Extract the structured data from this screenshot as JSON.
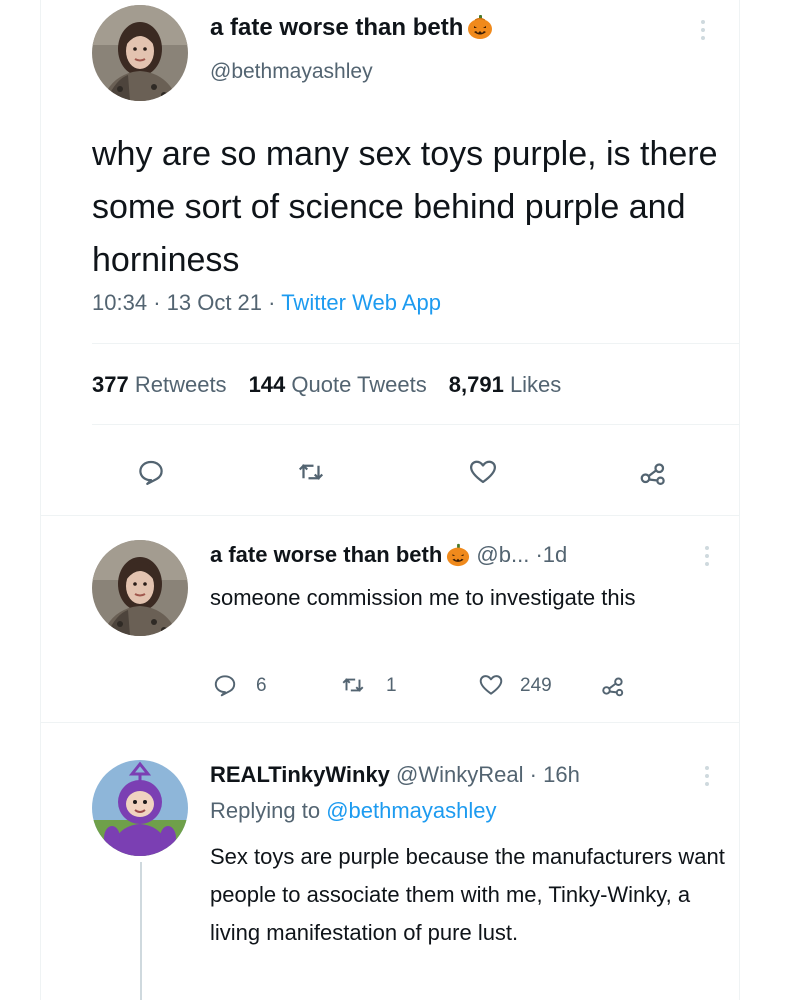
{
  "main_tweet": {
    "author_name": "a fate worse than beth",
    "author_handle": "@bethmayashley",
    "name_emoji": "pumpkin-icon",
    "text": "why are so many sex toys purple, is there some sort of science behind purple and horniness",
    "time": "10:34",
    "date": "13 Oct 21",
    "source": "Twitter Web App",
    "separator": "·",
    "stats": {
      "retweets_count": "377",
      "retweets_label": "Retweets",
      "quotes_count": "144",
      "quotes_label": "Quote Tweets",
      "likes_count": "8,791",
      "likes_label": "Likes"
    },
    "actions": [
      "reply-icon",
      "retweet-icon",
      "like-icon",
      "share-icon"
    ]
  },
  "replies": [
    {
      "author_name": "a fate worse than beth",
      "author_handle": "@b...",
      "time": "1d",
      "separator": "·",
      "text": "someone commission me to investigate this",
      "reply_count": "6",
      "retweet_count": "1",
      "like_count": "249"
    },
    {
      "author_name": "REALTinkyWinky",
      "author_handle": "@WinkyReal",
      "time": "16h",
      "separator": "·",
      "replying_label": "Replying to",
      "replying_to": "@bethmayashley",
      "text": "Sex toys are purple because the manufacturers want people to associate them with me, Tinky-Winky, a living manifestation of pure lust."
    }
  ],
  "colors": {
    "text": "#0f1419",
    "secondary": "#536471",
    "link": "#1d9bf0",
    "divider": "#eff3f4",
    "tinky_purple": "#7b3fb3"
  }
}
